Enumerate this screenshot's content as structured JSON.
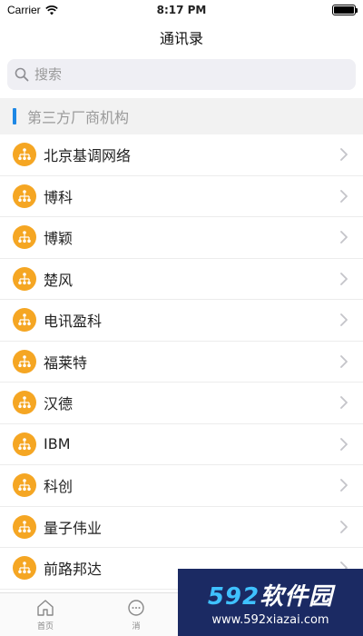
{
  "status": {
    "carrier": "Carrier",
    "time": "8:17 PM"
  },
  "nav": {
    "title": "通讯录"
  },
  "search": {
    "placeholder": "搜索"
  },
  "section": {
    "title": "第三方厂商机构"
  },
  "orgs": [
    {
      "label": "北京基调网络"
    },
    {
      "label": "博科"
    },
    {
      "label": "博颖"
    },
    {
      "label": "楚风"
    },
    {
      "label": "电讯盈科"
    },
    {
      "label": "福莱特"
    },
    {
      "label": "汉德"
    },
    {
      "label": "IBM"
    },
    {
      "label": "科创"
    },
    {
      "label": "量子伟业"
    },
    {
      "label": "前路邦达"
    }
  ],
  "tabs": [
    {
      "label": "首页",
      "icon": "home-icon"
    },
    {
      "label": "消",
      "icon": "message-icon"
    }
  ],
  "watermark": {
    "number": "592",
    "text": "软件园",
    "url": "www.592xiazai.com"
  },
  "colors": {
    "accent": "#1e88e5",
    "org_icon": "#f5a623",
    "watermark_bg": "#1b2a63"
  }
}
